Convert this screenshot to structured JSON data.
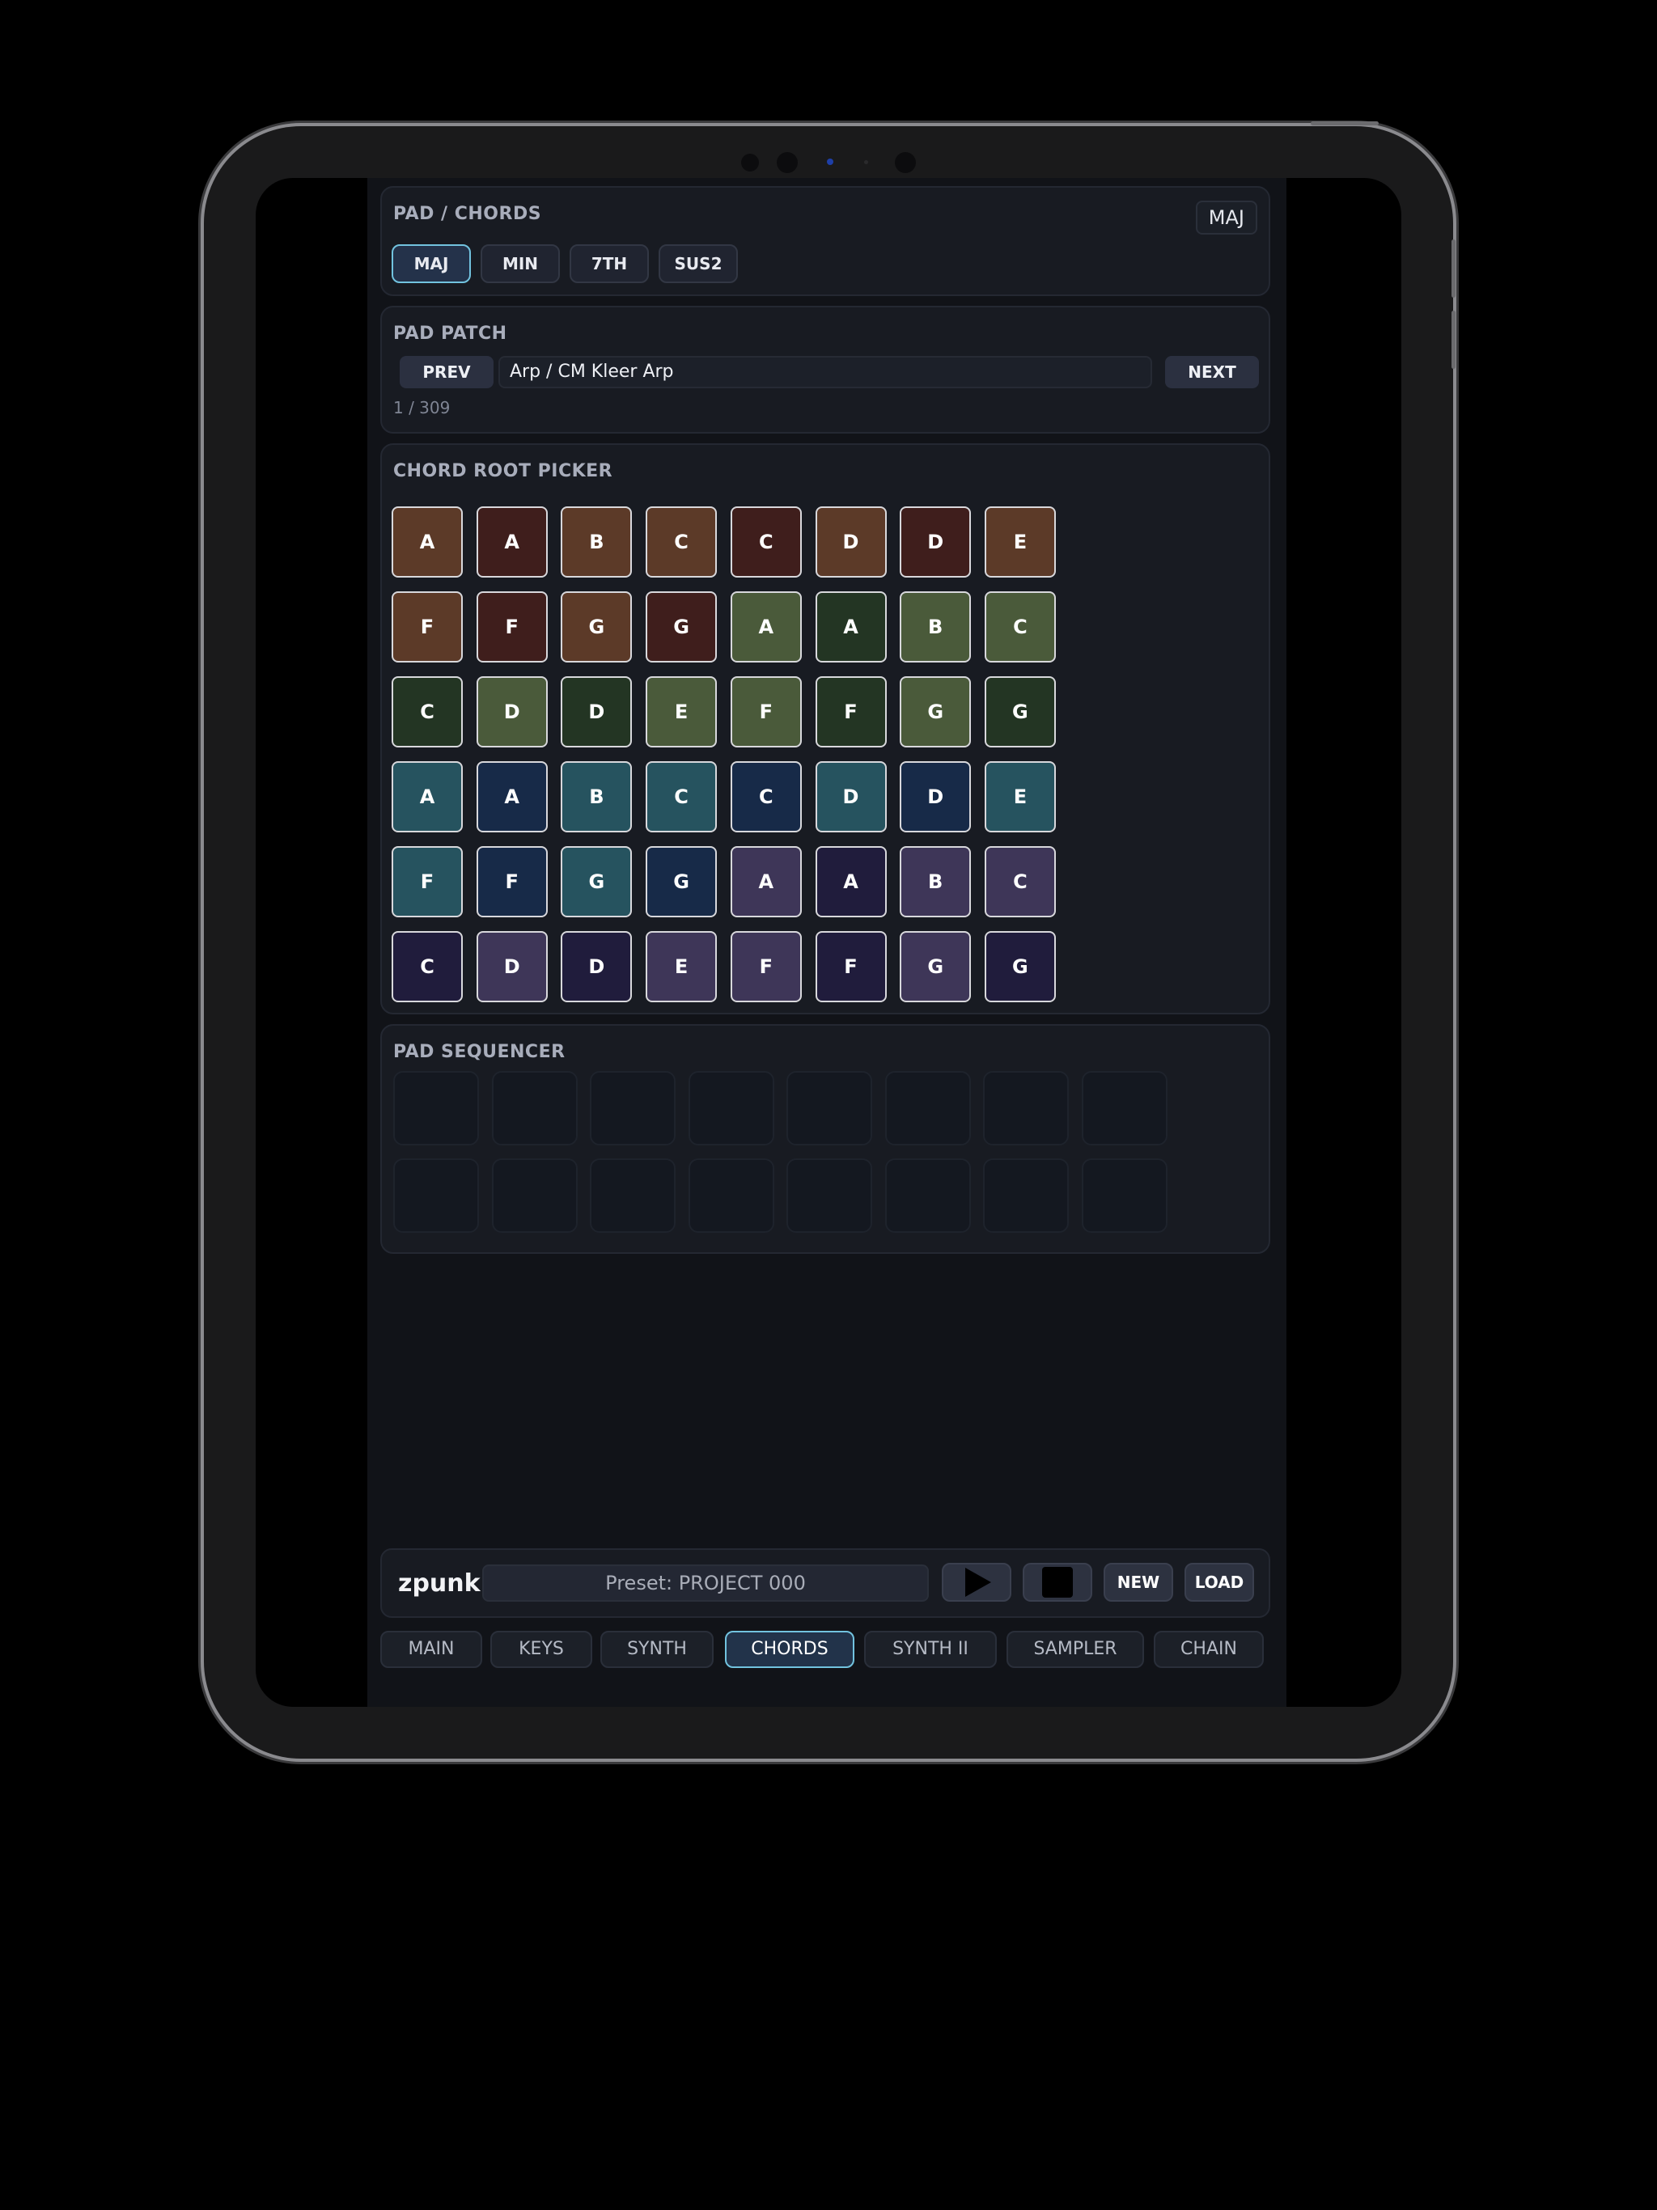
{
  "header": {
    "title": "PAD / CHORDS",
    "mode_badge": "MAJ"
  },
  "chord_types": [
    {
      "label": "MAJ",
      "active": true
    },
    {
      "label": "MIN",
      "active": false
    },
    {
      "label": "7TH",
      "active": false
    },
    {
      "label": "SUS2",
      "active": false
    }
  ],
  "patch": {
    "title": "PAD PATCH",
    "prev_label": "PREV",
    "next_label": "NEXT",
    "name": "Arp / CM Kleer Arp",
    "counter": "1 / 309"
  },
  "root_picker": {
    "title": "CHORD ROOT PICKER",
    "rows": [
      [
        "A",
        "A",
        "B",
        "C",
        "C",
        "D",
        "D",
        "E"
      ],
      [
        "F",
        "F",
        "G",
        "G",
        "A",
        "A",
        "B",
        "C"
      ],
      [
        "C",
        "D",
        "D",
        "E",
        "F",
        "F",
        "G",
        "G"
      ],
      [
        "A",
        "A",
        "B",
        "C",
        "C",
        "D",
        "D",
        "E"
      ],
      [
        "F",
        "F",
        "G",
        "G",
        "A",
        "A",
        "B",
        "C"
      ],
      [
        "C",
        "D",
        "D",
        "E",
        "F",
        "F",
        "G",
        "G"
      ]
    ],
    "colors": [
      [
        "#5c3a28",
        "#3f1e1c",
        "#5c3a28",
        "#5c3a28",
        "#3f1e1c",
        "#5c3a28",
        "#3f1e1c",
        "#5c3a28"
      ],
      [
        "#5c3a28",
        "#3f1e1c",
        "#5c3a28",
        "#3f1e1c",
        "#4a5a3a",
        "#233523",
        "#4a5a3a",
        "#4a5a3a"
      ],
      [
        "#233523",
        "#4a5a3a",
        "#233523",
        "#4a5a3a",
        "#4a5a3a",
        "#233523",
        "#4a5a3a",
        "#233523"
      ],
      [
        "#26535f",
        "#172a48",
        "#26535f",
        "#26535f",
        "#172a48",
        "#26535f",
        "#172a48",
        "#26535f"
      ],
      [
        "#26535f",
        "#172a48",
        "#26535f",
        "#172a48",
        "#3e3658",
        "#201c3c",
        "#3e3658",
        "#3e3658"
      ],
      [
        "#201c3c",
        "#3e3658",
        "#201c3c",
        "#3e3658",
        "#3e3658",
        "#201c3c",
        "#3e3658",
        "#201c3c"
      ]
    ]
  },
  "sequencer": {
    "title": "PAD SEQUENCER",
    "rows": 2,
    "cols": 8
  },
  "transport": {
    "brand": "zpunk",
    "preset": "Preset: PROJECT 000",
    "new_label": "NEW",
    "load_label": "LOAD"
  },
  "tabs": [
    {
      "label": "MAIN",
      "active": false
    },
    {
      "label": "KEYS",
      "active": false
    },
    {
      "label": "SYNTH",
      "active": false
    },
    {
      "label": "CHORDS",
      "active": true
    },
    {
      "label": "SYNTH II",
      "active": false
    },
    {
      "label": "SAMPLER",
      "active": false
    },
    {
      "label": "CHAIN",
      "active": false
    }
  ],
  "accent": "#72c3df"
}
